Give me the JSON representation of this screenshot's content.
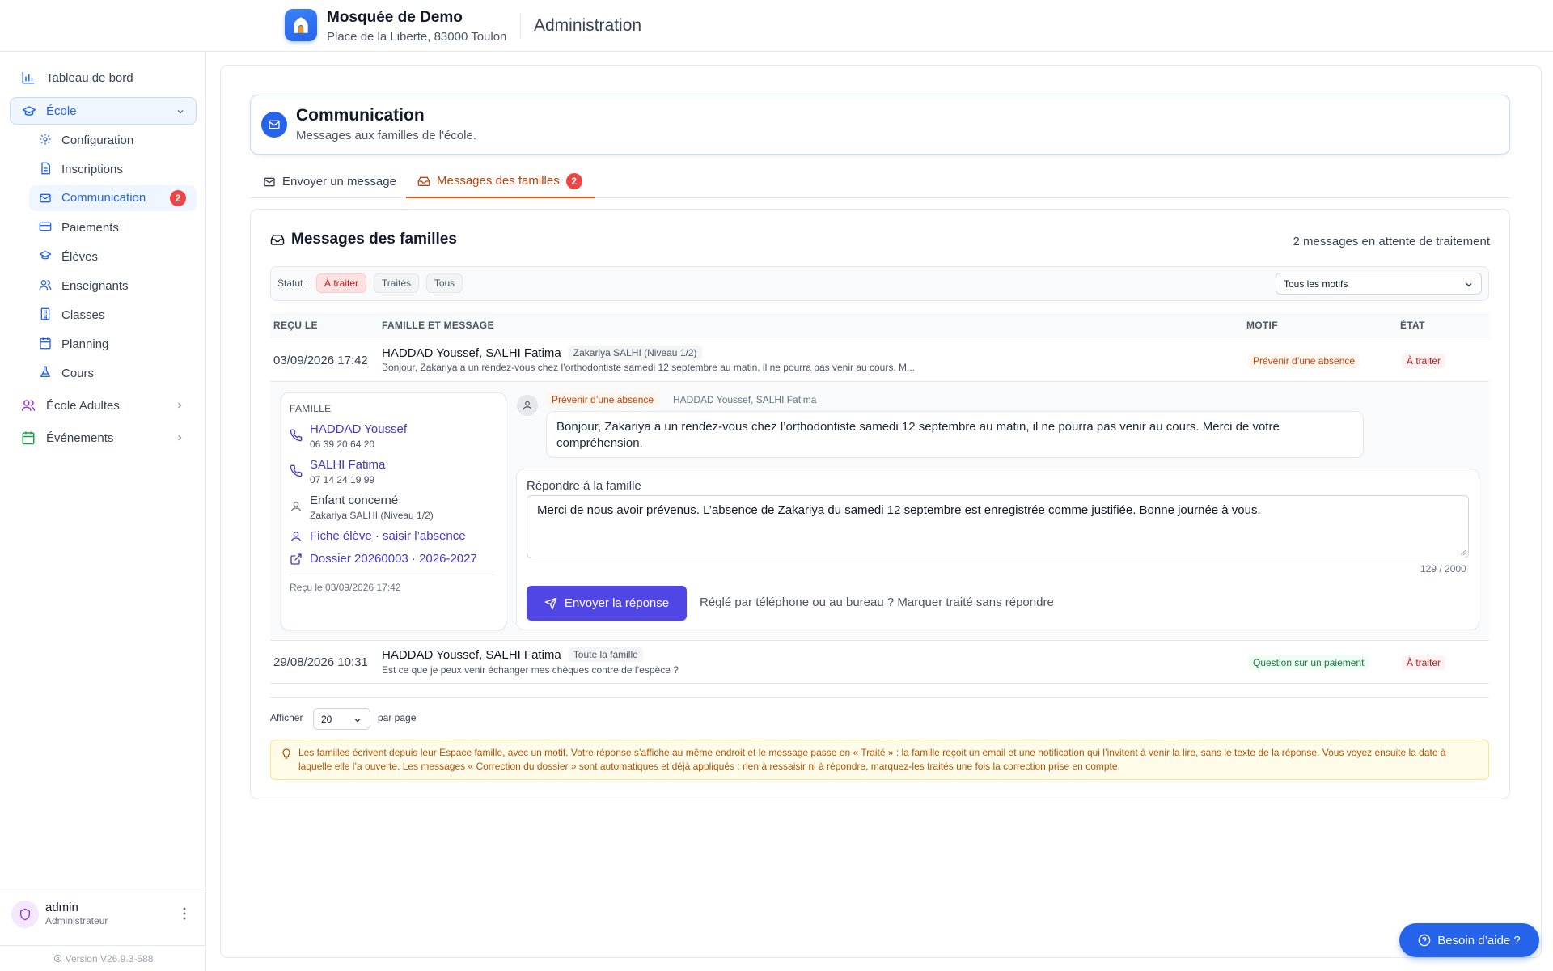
{
  "header": {
    "org_name": "Mosquée de Demo",
    "org_address": "Place de la Liberte, 83000 Toulon",
    "section": "Administration"
  },
  "sidebar": {
    "dashboard": "Tableau de bord",
    "ecole": "École",
    "sub_items": [
      {
        "label": "Configuration",
        "icon": "gear-icon"
      },
      {
        "label": "Inscriptions",
        "icon": "document-icon"
      },
      {
        "label": "Communication",
        "icon": "mail-icon",
        "badge": "2",
        "active": true
      },
      {
        "label": "Paiements",
        "icon": "card-icon"
      },
      {
        "label": "Élèves",
        "icon": "graduation-cap-icon"
      },
      {
        "label": "Enseignants",
        "icon": "users-icon"
      },
      {
        "label": "Classes",
        "icon": "building-icon"
      },
      {
        "label": "Planning",
        "icon": "calendar-icon"
      },
      {
        "label": "Cours",
        "icon": "flask-icon"
      }
    ],
    "ecole_adultes": "École Adultes",
    "evenements": "Événements",
    "user": {
      "name": "admin",
      "role": "Administrateur"
    },
    "version": "Version V26.9.3-588"
  },
  "page": {
    "title": "Communication",
    "subtitle": "Messages aux familles de l'école."
  },
  "tabs": {
    "send": "Envoyer un message",
    "inbox": "Messages des familles",
    "inbox_badge": "2"
  },
  "inbox": {
    "title": "Messages des familles",
    "pending": "2 messages en attente de traitement",
    "filters": {
      "label": "Statut :",
      "a_traiter": "À traiter",
      "traites": "Traités",
      "tous": "Tous",
      "motif_select": "Tous les motifs"
    },
    "columns": {
      "recu": "REÇU LE",
      "famille": "FAMILLE ET MESSAGE",
      "motif": "MOTIF",
      "etat": "ÉTAT"
    },
    "rows": [
      {
        "date": "03/09/2026 17:42",
        "names": "HADDAD Youssef, SALHI Fatima",
        "tag": "Zakariya SALHI (Niveau 1/2)",
        "excerpt": "Bonjour, Zakariya a un rendez-vous chez l’orthodontiste samedi 12 septembre au matin, il ne pourra pas venir au cours. M...",
        "motif": "Prévenir d’une absence",
        "etat": "À traiter"
      },
      {
        "date": "29/08/2026 10:31",
        "names": "HADDAD Youssef, SALHI Fatima",
        "tag": "Toute la famille",
        "excerpt": "Est ce que je peux venir échanger mes chèques contre de l’espèce ?",
        "motif": "Question sur un paiement",
        "etat": "À traiter"
      }
    ],
    "detail": {
      "family_label": "FAMILLE",
      "contacts": [
        {
          "name": "HADDAD Youssef",
          "phone": "06 39 20 64 20"
        },
        {
          "name": "SALHI Fatima",
          "phone": "07 14 24 19 99"
        }
      ],
      "child_label": "Enfant concerné",
      "child_value": "Zakariya SALHI (Niveau 1/2)",
      "student_link": "Fiche élève · saisir l’absence",
      "dossier_link": "Dossier 20260003 · 2026-2027",
      "received": "Reçu le 03/09/2026 17:42",
      "message_motif": "Prévenir d’une absence",
      "message_from": "HADDAD Youssef, SALHI Fatima",
      "message_text": "Bonjour, Zakariya a un rendez-vous chez l’orthodontiste samedi 12 septembre au matin, il ne pourra pas venir au cours. Merci de votre compréhension.",
      "reply_label": "Répondre à la famille",
      "reply_text": "Merci de nous avoir prévenus. L’absence de Zakariya du samedi 12 septembre est enregistrée comme justifiée. Bonne journée à vous.",
      "counter": "129 / 2000",
      "send_button": "Envoyer la réponse",
      "mark_link": "Réglé par téléphone ou au bureau ? Marquer traité sans répondre"
    },
    "pagination": {
      "show": "Afficher",
      "value": "20",
      "per_page": "par page"
    },
    "notice": "Les familles écrivent depuis leur Espace famille, avec un motif. Votre réponse s’affiche au même endroit et le message passe en « Traité » : la famille reçoit un email et une notification qui l’invitent à venir la lire, sans le texte de la réponse. Vous voyez ensuite la date à laquelle elle l’a ouverte. Les messages « Correction du dossier » sont automatiques et déjà appliqués : rien à ressaisir ni à répondre, marquez-les traités une fois la correction prise en compte."
  },
  "help": "Besoin d’aide ?",
  "colors": {
    "primary": "#2563eb",
    "accent": "#4f46e5",
    "tab_active": "#ea580c",
    "danger": "#ef4444"
  }
}
